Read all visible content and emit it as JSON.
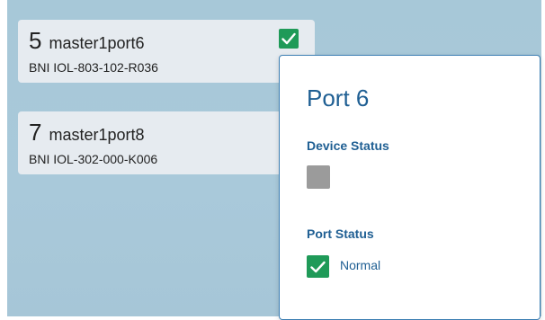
{
  "ports": [
    {
      "number": "5",
      "name": "master1port6",
      "model": "BNI IOL-803-102-R036",
      "status": "ok"
    },
    {
      "number": "7",
      "name": "master1port8",
      "model": "BNI IOL-302-000-K006"
    }
  ],
  "popover": {
    "title": "Port 6",
    "device_status_label": "Device Status",
    "device_status_color": "#9b9b9b",
    "port_status_label": "Port Status",
    "port_status_value": "Normal",
    "port_status_color": "#1f9a58"
  },
  "colors": {
    "accent": "#1f5f93",
    "ok_green": "#1f9a58",
    "card_bg": "#e6ebf0",
    "background": "#a8c8d9"
  },
  "icons": {
    "port_ok": "check-icon"
  }
}
